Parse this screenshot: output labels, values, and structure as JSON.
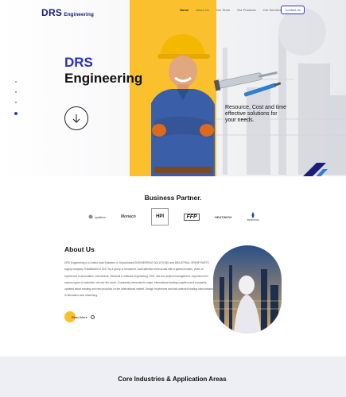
{
  "brand": {
    "name": "DRS",
    "sub": "Engineering"
  },
  "nav": {
    "items": [
      "Home",
      "About Us",
      "Our Team",
      "Our Products",
      "Our Services"
    ],
    "contact": "Contact us"
  },
  "hero": {
    "title_line1": "DRS",
    "title_line2": "Engineering",
    "tagline": "Resource, Cost and time effective solutions for your needs."
  },
  "partners": {
    "title": "Business Partner.",
    "logos": [
      "syaltina",
      "Monaco",
      "HPI",
      "FFP",
      "HEATWICH",
      "BIRBOSSE"
    ]
  },
  "about": {
    "title": "About Us",
    "text": "DRS Engineering is a United Arab Emirates, in Dubai based ENGINEERING SOLUTIONS and INDUSTRIAL SPARE PARTS supply company. Established in 2017 by a group of renowned, multi-talented technocrats with a global mindset, years of experience in automation, mechanical, electrical & software engineering. EHS, site and project management, experienced in various types of industries, all over the world. Constantly connected to major, international leading suppliers and constantly updated about existing and new products on the international market. Design experience and well-selected leading subcontractors in fabrication and machining.",
    "read_more": "Read More"
  },
  "industries": {
    "title": "Core Industries & Application Areas"
  },
  "colors": {
    "accent": "#fbc02d",
    "primary": "#2d2fbf",
    "dark": "#111111"
  }
}
